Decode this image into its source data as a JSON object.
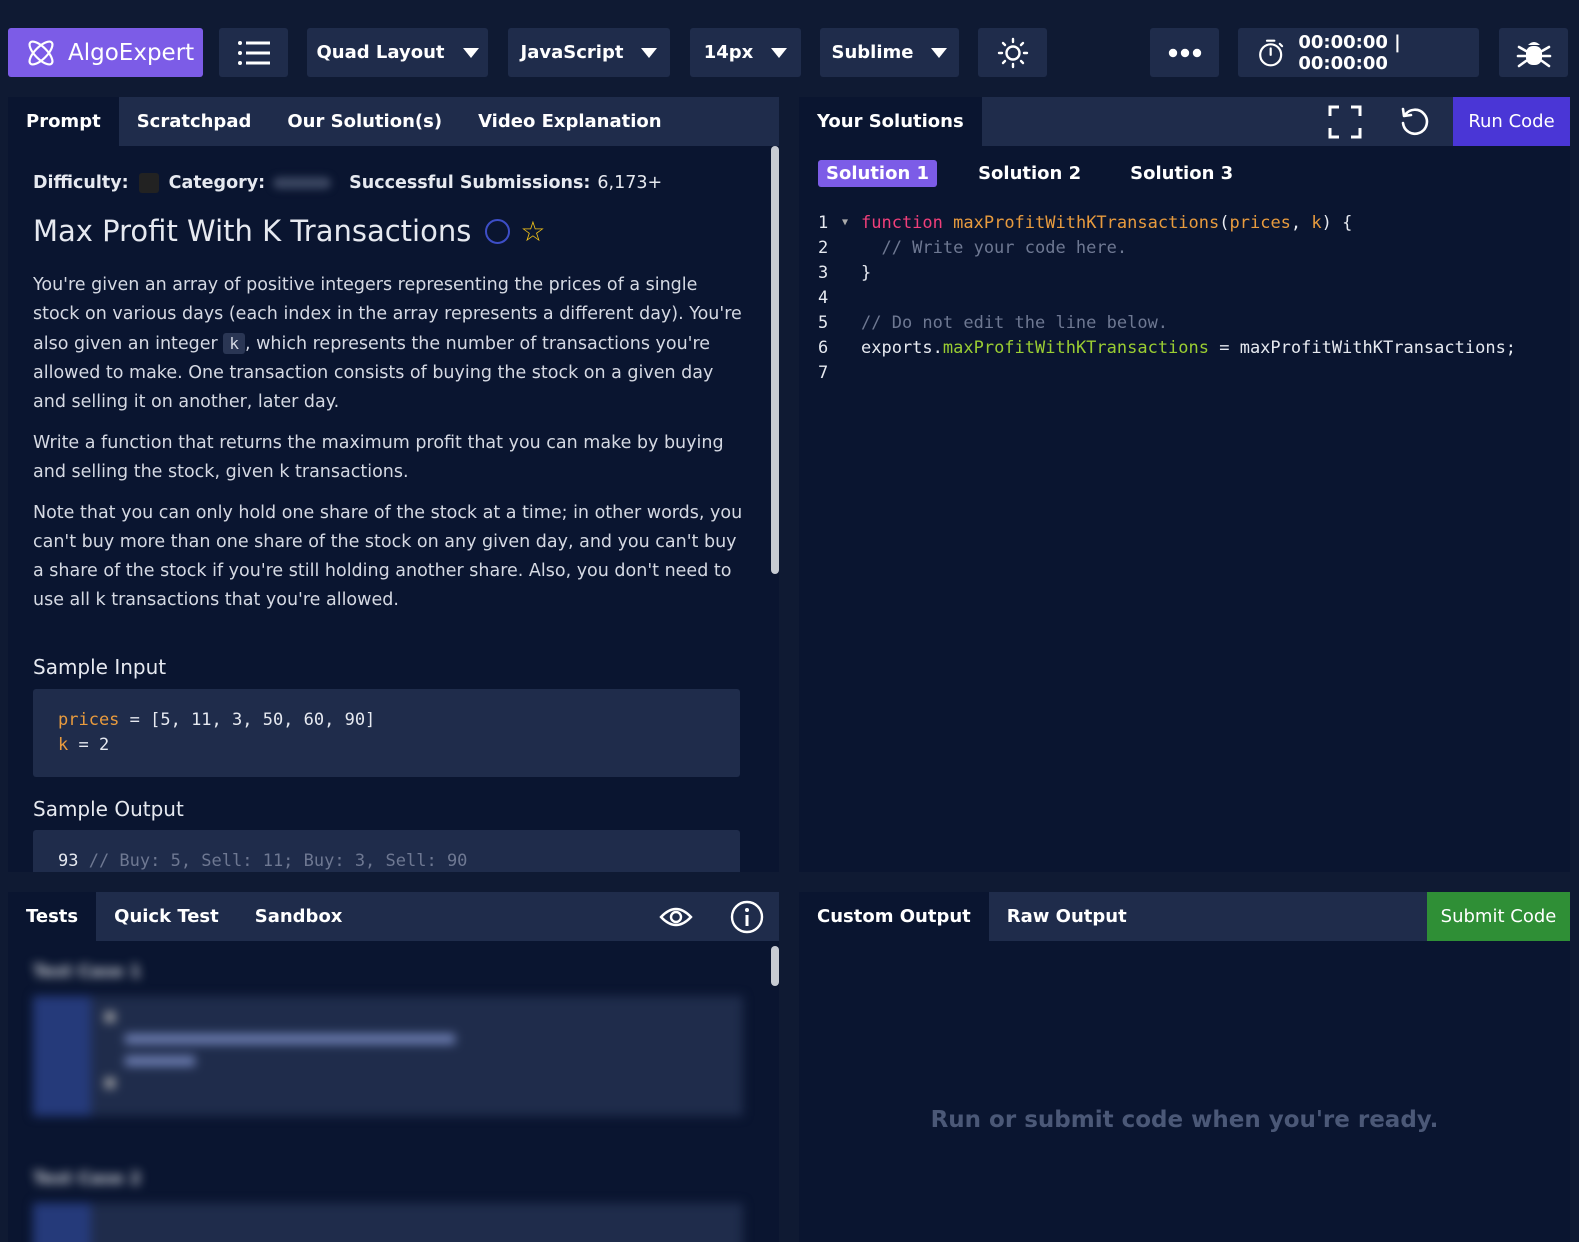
{
  "topbar": {
    "brand": "AlgoExpert",
    "layout": "Quad Layout",
    "language": "JavaScript",
    "font_size": "14px",
    "keymap": "Sublime",
    "timer": "00:00:00 | 00:00:00"
  },
  "prompt_panel": {
    "tabs": [
      "Prompt",
      "Scratchpad",
      "Our Solution(s)",
      "Video Explanation"
    ],
    "difficulty_label": "Difficulty:",
    "category_label": "Category:",
    "submissions_label": "Successful Submissions:",
    "submissions_value": "6,173+",
    "title": "Max Profit With K Transactions",
    "para1_a": "You're given an array of positive integers representing the prices of a single stock on various days (each index in the array represents a different day). You're also given an integer ",
    "para1_code": "k",
    "para1_b": ", which represents the number of transactions you're allowed to make. One transaction consists of buying the stock on a given day and selling it on another, later day.",
    "para2": "Write a function that returns the maximum profit that you can make by buying and selling the stock, given k transactions.",
    "para3": "Note that you can only hold one share of the stock at a time; in other words, you can't buy more than one share of the stock on any given day, and you can't buy a share of the stock if you're still holding another share. Also, you don't need to use all k transactions that you're allowed.",
    "sample_input_heading": "Sample Input",
    "sample_input": {
      "l1_var": "prices",
      "l1_rest": " = [5, 11, 3, 50, 60, 90]",
      "l2_var": "k",
      "l2_rest": " = 2"
    },
    "sample_output_heading": "Sample Output",
    "sample_output": {
      "value": "93",
      "comment": " // Buy: 5, Sell: 11; Buy: 3, Sell: 90"
    }
  },
  "solutions_panel": {
    "tab": "Your Solutions",
    "run_label": "Run Code",
    "solution_tabs": [
      "Solution 1",
      "Solution 2",
      "Solution 3"
    ],
    "code": {
      "l1_kw": "function",
      "l1_fn": "maxProfitWithKTransactions",
      "l1_p1": "prices",
      "l1_p2": "k",
      "l2": "  // Write your code here.",
      "l3": "}",
      "l5": "// Do not edit the line below.",
      "l6_a": "exports.",
      "l6_b": "maxProfitWithKTransactions",
      "l6_c": " = maxProfitWithKTransactions;"
    },
    "line_numbers": [
      "1",
      "2",
      "3",
      "4",
      "5",
      "6",
      "7"
    ]
  },
  "tests_panel": {
    "tabs": [
      "Tests",
      "Quick Test",
      "Sandbox"
    ],
    "test_case_1": "Test Case 1",
    "test_case_2": "Test Case 2"
  },
  "output_panel": {
    "tabs": [
      "Custom Output",
      "Raw Output"
    ],
    "submit_label": "Submit Code",
    "empty_message": "Run or submit code when you're ready."
  }
}
